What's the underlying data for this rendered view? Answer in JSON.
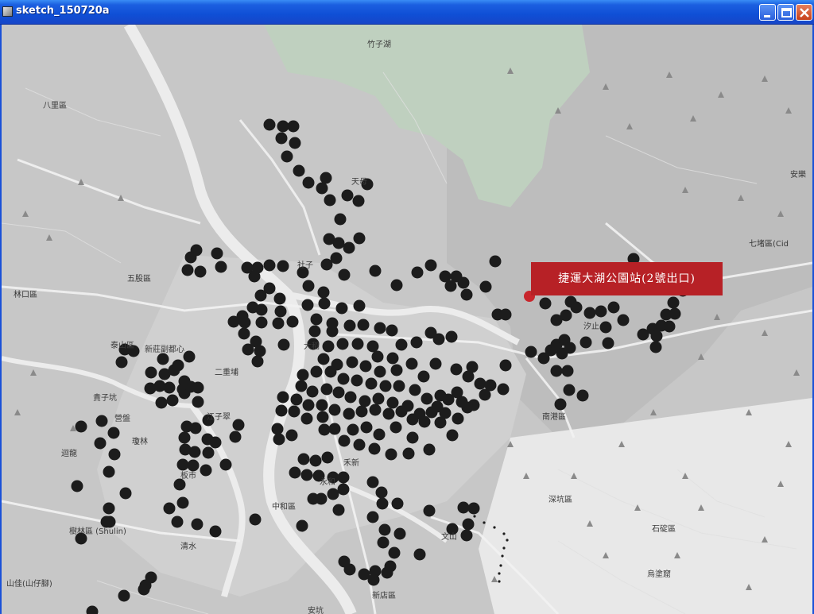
{
  "window": {
    "title": "sketch_150720a",
    "buttons": {
      "minimize": "minimize-button",
      "maximize": "maximize-button",
      "close": "close-button"
    }
  },
  "map": {
    "labels": [
      {
        "text": "竹子湖"
      },
      {
        "text": "八里區"
      },
      {
        "text": "天母"
      },
      {
        "text": "五股區"
      },
      {
        "text": "社子"
      },
      {
        "text": "林口區"
      },
      {
        "text": "大稻"
      },
      {
        "text": "新莊副都心"
      },
      {
        "text": "二重埔"
      },
      {
        "text": "泰山區"
      },
      {
        "text": "營盤"
      },
      {
        "text": "瓊林"
      },
      {
        "text": "貴子坑"
      },
      {
        "text": "迴龍"
      },
      {
        "text": "江子翠"
      },
      {
        "text": "板市"
      },
      {
        "text": "中和區"
      },
      {
        "text": "永和"
      },
      {
        "text": "禾新"
      },
      {
        "text": "樹林區 (Shulin)"
      },
      {
        "text": "清水"
      },
      {
        "text": "山佳(山仔腳)"
      },
      {
        "text": "新店區"
      },
      {
        "text": "安坑"
      },
      {
        "text": "南港區"
      },
      {
        "text": "汐止"
      },
      {
        "text": "七堵區(Cid"
      },
      {
        "text": "安樂"
      },
      {
        "text": "深坑區"
      },
      {
        "text": "石碇區"
      },
      {
        "text": "烏塗窟"
      },
      {
        "text": "文山"
      }
    ],
    "marker_color": "#1c1c1c",
    "highlight": {
      "label": "捷運大湖公園站(2號出口)",
      "color": "#b72126"
    }
  }
}
